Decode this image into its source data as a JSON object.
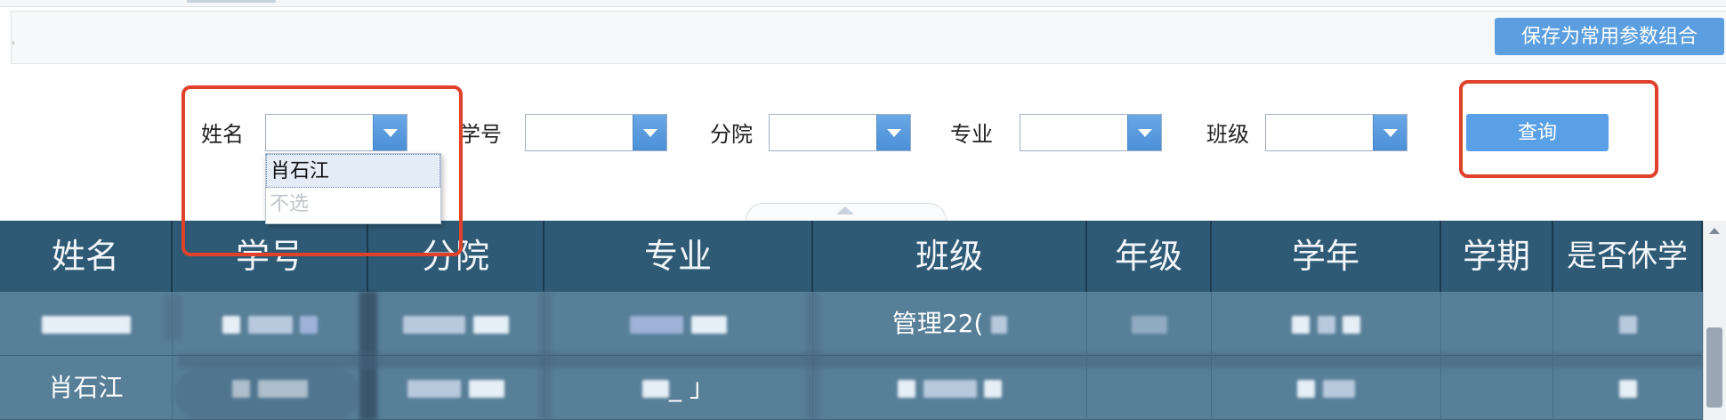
{
  "toolbar": {
    "save_label": "保存为常用参数组合"
  },
  "filters": {
    "name_label": "姓名",
    "student_id_label": "学号",
    "college_label": "分院",
    "major_label": "专业",
    "class_label": "班级",
    "query_label": "查询"
  },
  "name_dropdown": {
    "options": [
      "肖石江",
      "不选"
    ],
    "selected": "肖石江"
  },
  "table": {
    "columns": [
      "姓名",
      "学号",
      "分院",
      "专业",
      "班级",
      "年级",
      "学年",
      "学期",
      "是否休学"
    ],
    "rows": [
      {
        "class_fragment": "管理22("
      },
      {
        "name": "肖石江",
        "major_fragment": "_ 」"
      }
    ]
  },
  "colors": {
    "header_bg": "#2f5a75",
    "body_bg": "#577f98",
    "button_blue": "#5aa0e6",
    "highlight_red": "#e0412a"
  }
}
